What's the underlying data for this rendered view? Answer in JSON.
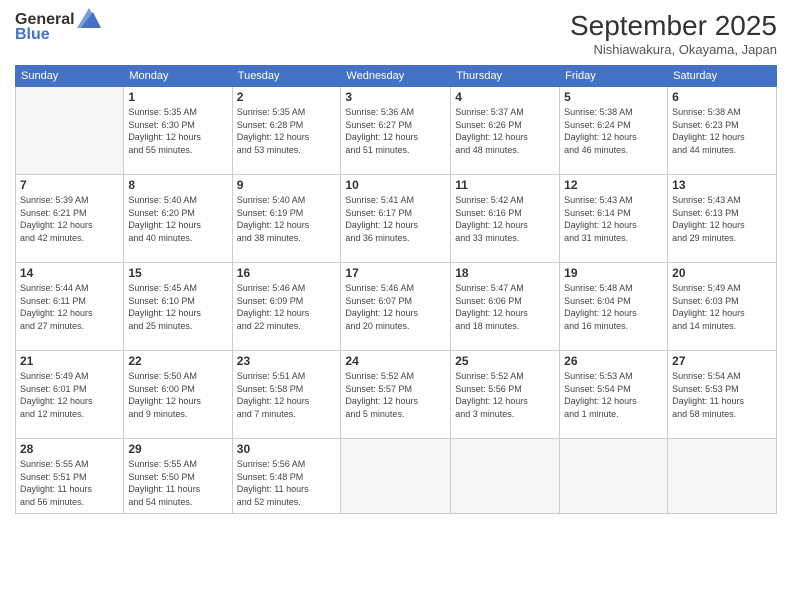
{
  "logo": {
    "general": "General",
    "blue": "Blue"
  },
  "header": {
    "month": "September 2025",
    "location": "Nishiawakura, Okayama, Japan"
  },
  "weekdays": [
    "Sunday",
    "Monday",
    "Tuesday",
    "Wednesday",
    "Thursday",
    "Friday",
    "Saturday"
  ],
  "weeks": [
    [
      {
        "day": "",
        "info": ""
      },
      {
        "day": "1",
        "info": "Sunrise: 5:35 AM\nSunset: 6:30 PM\nDaylight: 12 hours\nand 55 minutes."
      },
      {
        "day": "2",
        "info": "Sunrise: 5:35 AM\nSunset: 6:28 PM\nDaylight: 12 hours\nand 53 minutes."
      },
      {
        "day": "3",
        "info": "Sunrise: 5:36 AM\nSunset: 6:27 PM\nDaylight: 12 hours\nand 51 minutes."
      },
      {
        "day": "4",
        "info": "Sunrise: 5:37 AM\nSunset: 6:26 PM\nDaylight: 12 hours\nand 48 minutes."
      },
      {
        "day": "5",
        "info": "Sunrise: 5:38 AM\nSunset: 6:24 PM\nDaylight: 12 hours\nand 46 minutes."
      },
      {
        "day": "6",
        "info": "Sunrise: 5:38 AM\nSunset: 6:23 PM\nDaylight: 12 hours\nand 44 minutes."
      }
    ],
    [
      {
        "day": "7",
        "info": "Sunrise: 5:39 AM\nSunset: 6:21 PM\nDaylight: 12 hours\nand 42 minutes."
      },
      {
        "day": "8",
        "info": "Sunrise: 5:40 AM\nSunset: 6:20 PM\nDaylight: 12 hours\nand 40 minutes."
      },
      {
        "day": "9",
        "info": "Sunrise: 5:40 AM\nSunset: 6:19 PM\nDaylight: 12 hours\nand 38 minutes."
      },
      {
        "day": "10",
        "info": "Sunrise: 5:41 AM\nSunset: 6:17 PM\nDaylight: 12 hours\nand 36 minutes."
      },
      {
        "day": "11",
        "info": "Sunrise: 5:42 AM\nSunset: 6:16 PM\nDaylight: 12 hours\nand 33 minutes."
      },
      {
        "day": "12",
        "info": "Sunrise: 5:43 AM\nSunset: 6:14 PM\nDaylight: 12 hours\nand 31 minutes."
      },
      {
        "day": "13",
        "info": "Sunrise: 5:43 AM\nSunset: 6:13 PM\nDaylight: 12 hours\nand 29 minutes."
      }
    ],
    [
      {
        "day": "14",
        "info": "Sunrise: 5:44 AM\nSunset: 6:11 PM\nDaylight: 12 hours\nand 27 minutes."
      },
      {
        "day": "15",
        "info": "Sunrise: 5:45 AM\nSunset: 6:10 PM\nDaylight: 12 hours\nand 25 minutes."
      },
      {
        "day": "16",
        "info": "Sunrise: 5:46 AM\nSunset: 6:09 PM\nDaylight: 12 hours\nand 22 minutes."
      },
      {
        "day": "17",
        "info": "Sunrise: 5:46 AM\nSunset: 6:07 PM\nDaylight: 12 hours\nand 20 minutes."
      },
      {
        "day": "18",
        "info": "Sunrise: 5:47 AM\nSunset: 6:06 PM\nDaylight: 12 hours\nand 18 minutes."
      },
      {
        "day": "19",
        "info": "Sunrise: 5:48 AM\nSunset: 6:04 PM\nDaylight: 12 hours\nand 16 minutes."
      },
      {
        "day": "20",
        "info": "Sunrise: 5:49 AM\nSunset: 6:03 PM\nDaylight: 12 hours\nand 14 minutes."
      }
    ],
    [
      {
        "day": "21",
        "info": "Sunrise: 5:49 AM\nSunset: 6:01 PM\nDaylight: 12 hours\nand 12 minutes."
      },
      {
        "day": "22",
        "info": "Sunrise: 5:50 AM\nSunset: 6:00 PM\nDaylight: 12 hours\nand 9 minutes."
      },
      {
        "day": "23",
        "info": "Sunrise: 5:51 AM\nSunset: 5:58 PM\nDaylight: 12 hours\nand 7 minutes."
      },
      {
        "day": "24",
        "info": "Sunrise: 5:52 AM\nSunset: 5:57 PM\nDaylight: 12 hours\nand 5 minutes."
      },
      {
        "day": "25",
        "info": "Sunrise: 5:52 AM\nSunset: 5:56 PM\nDaylight: 12 hours\nand 3 minutes."
      },
      {
        "day": "26",
        "info": "Sunrise: 5:53 AM\nSunset: 5:54 PM\nDaylight: 12 hours\nand 1 minute."
      },
      {
        "day": "27",
        "info": "Sunrise: 5:54 AM\nSunset: 5:53 PM\nDaylight: 11 hours\nand 58 minutes."
      }
    ],
    [
      {
        "day": "28",
        "info": "Sunrise: 5:55 AM\nSunset: 5:51 PM\nDaylight: 11 hours\nand 56 minutes."
      },
      {
        "day": "29",
        "info": "Sunrise: 5:55 AM\nSunset: 5:50 PM\nDaylight: 11 hours\nand 54 minutes."
      },
      {
        "day": "30",
        "info": "Sunrise: 5:56 AM\nSunset: 5:48 PM\nDaylight: 11 hours\nand 52 minutes."
      },
      {
        "day": "",
        "info": ""
      },
      {
        "day": "",
        "info": ""
      },
      {
        "day": "",
        "info": ""
      },
      {
        "day": "",
        "info": ""
      }
    ]
  ]
}
